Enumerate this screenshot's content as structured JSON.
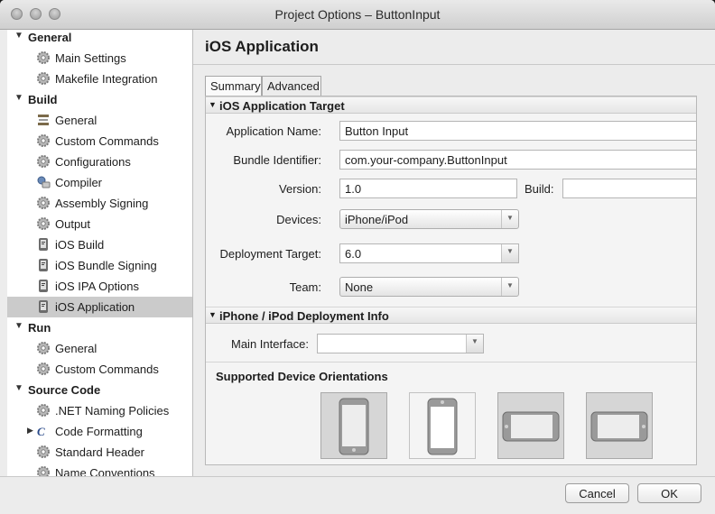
{
  "window": {
    "title": "Project Options – ButtonInput"
  },
  "sidebar": {
    "groups": [
      {
        "label": "General",
        "items": [
          {
            "label": "Main Settings",
            "icon": "gear-icon"
          },
          {
            "label": "Makefile Integration",
            "icon": "gear-icon"
          }
        ]
      },
      {
        "label": "Build",
        "items": [
          {
            "label": "General",
            "icon": "hammer-icon"
          },
          {
            "label": "Custom Commands",
            "icon": "gear-icon"
          },
          {
            "label": "Configurations",
            "icon": "gear-icon"
          },
          {
            "label": "Compiler",
            "icon": "compiler-icon"
          },
          {
            "label": "Assembly Signing",
            "icon": "gear-icon"
          },
          {
            "label": "Output",
            "icon": "gear-icon"
          },
          {
            "label": "iOS Build",
            "icon": "ios-device-icon"
          },
          {
            "label": "iOS Bundle Signing",
            "icon": "ios-device-icon"
          },
          {
            "label": "iOS IPA Options",
            "icon": "ios-device-icon"
          },
          {
            "label": "iOS Application",
            "icon": "ios-device-icon",
            "selected": true
          }
        ]
      },
      {
        "label": "Run",
        "items": [
          {
            "label": "General",
            "icon": "gear-icon"
          },
          {
            "label": "Custom Commands",
            "icon": "gear-icon"
          }
        ]
      },
      {
        "label": "Source Code",
        "items": [
          {
            "label": ".NET Naming Policies",
            "icon": "gear-icon"
          },
          {
            "label": "Code Formatting",
            "icon": "code-format-icon",
            "expandable": true
          },
          {
            "label": "Standard Header",
            "icon": "gear-icon"
          },
          {
            "label": "Name Conventions",
            "icon": "gear-icon"
          }
        ]
      }
    ]
  },
  "main": {
    "title": "iOS Application",
    "tabs": [
      {
        "label": "Summary",
        "active": true
      },
      {
        "label": "Advanced"
      }
    ],
    "target_section": "iOS Application Target",
    "fields": {
      "app_name_label": "Application Name:",
      "app_name_value": "Button Input",
      "bundle_id_label": "Bundle Identifier:",
      "bundle_id_value": "com.your-company.ButtonInput",
      "version_label": "Version:",
      "version_value": "1.0",
      "build_label": "Build:",
      "build_value": "",
      "devices_label": "Devices:",
      "devices_value": "iPhone/iPod",
      "deploy_label": "Deployment Target:",
      "deploy_value": "6.0",
      "team_label": "Team:",
      "team_value": "None"
    },
    "deploy_section": "iPhone / iPod Deployment Info",
    "main_interface_label": "Main Interface:",
    "main_interface_value": "",
    "orientations_title": "Supported Device Orientations",
    "orientations": [
      {
        "name": "portrait",
        "enabled": true
      },
      {
        "name": "upside-down",
        "enabled": false
      },
      {
        "name": "landscape-left",
        "enabled": true
      },
      {
        "name": "landscape-right",
        "enabled": true
      }
    ]
  },
  "footer": {
    "cancel_label": "Cancel",
    "ok_label": "OK"
  }
}
